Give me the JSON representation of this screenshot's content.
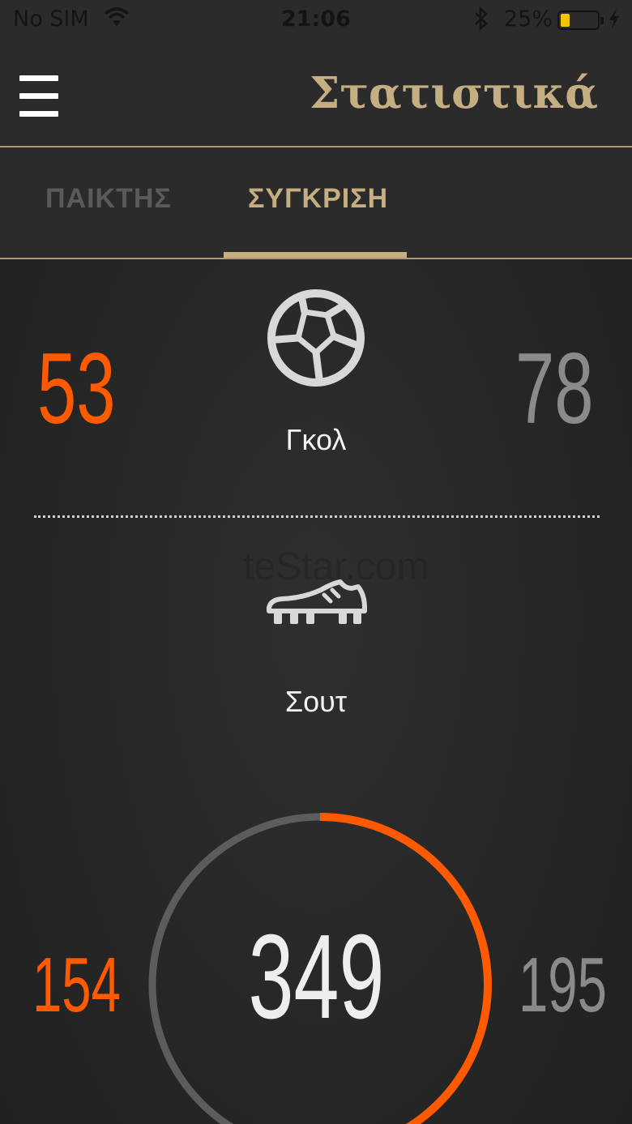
{
  "status_bar": {
    "carrier": "No SIM",
    "time": "21:06",
    "battery_percent": "25%",
    "battery_level": 0.25,
    "wifi_icon": "wifi-icon",
    "bluetooth_icon": "bluetooth-icon",
    "charging_icon": "charging-bolt-icon"
  },
  "header": {
    "title": "Στατιστικά",
    "menu_icon": "hamburger-menu-icon"
  },
  "tabs": [
    {
      "label": "ΠΑΙΚΤΗΣ",
      "active": false
    },
    {
      "label": "ΣΥΓΚΡΙΣΗ",
      "active": true
    }
  ],
  "stats": {
    "goals": {
      "label": "Γκολ",
      "icon": "football-icon",
      "left_value": "53",
      "right_value": "78"
    },
    "shots": {
      "label": "Σουτ",
      "icon": "football-boot-icon",
      "left_value": "154",
      "right_value": "195",
      "total": "349",
      "left_fraction": 0.44
    }
  },
  "watermark": "teStar.com",
  "colors": {
    "accent_gold": "#c4ae82",
    "player_orange": "#ff5a00",
    "opponent_gray": "#8a8a8a",
    "background": "#262626"
  }
}
